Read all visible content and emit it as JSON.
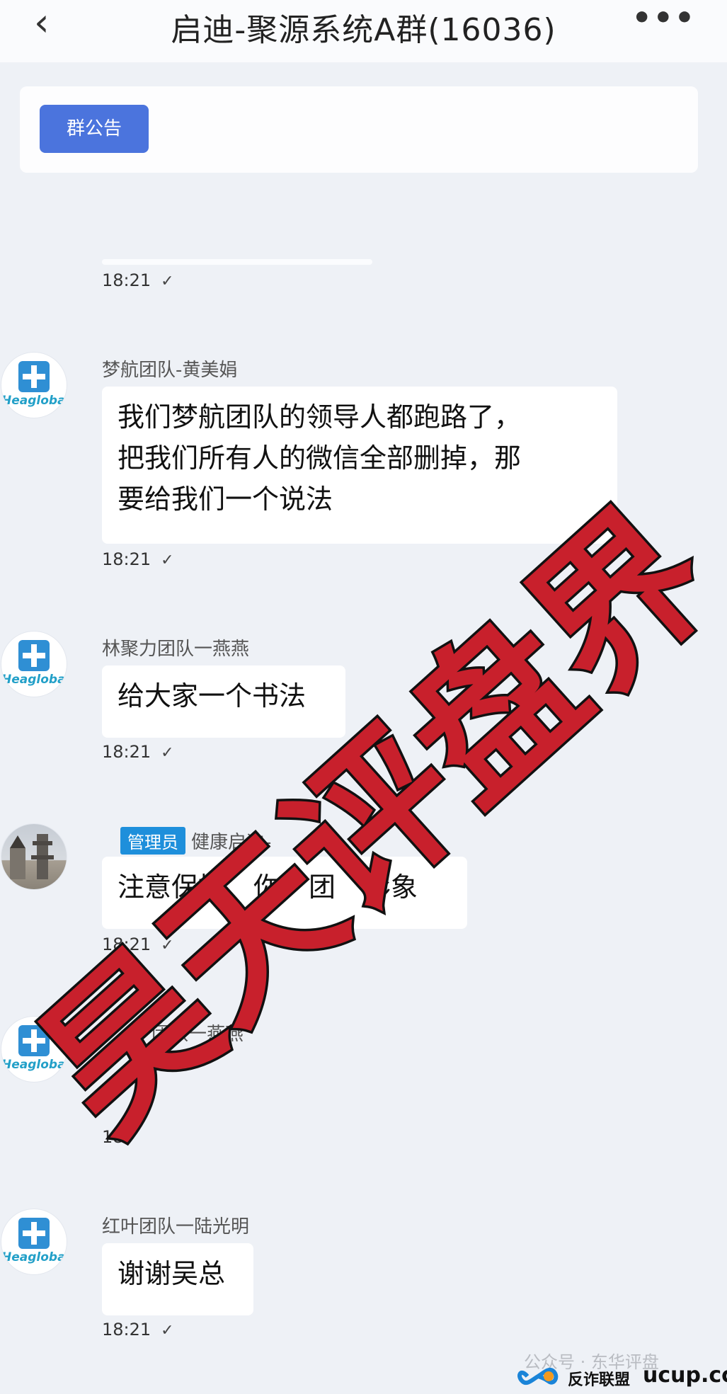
{
  "header": {
    "back_icon": "chevron-left-icon",
    "title": "启迪-聚源系统A群(16036)",
    "more_icon": "more-dots-icon"
  },
  "notice": {
    "button_label": "群公告"
  },
  "messages": [
    {
      "time": "18:21"
    },
    {
      "sender": "梦航团队-黄美娟",
      "text_lines": [
        "我们梦航团队的领导人都跑路了，",
        "把我们所有人的微信全部删掉，那",
        "要给我们一个说法"
      ],
      "time": "18:21",
      "avatar": "healthglobal-logo"
    },
    {
      "sender": "林聚力团队一燕燕",
      "text": "给大家一个书法",
      "time": "18:21",
      "avatar": "healthglobal-logo"
    },
    {
      "badge": "管理员",
      "sender": "健康启迪-",
      "text": "注意保持",
      "text_b": "你",
      "text_c": "团",
      "text_d": "形象",
      "time": "18:21",
      "avatar": "tower-photo"
    },
    {
      "sender": "团队一燕燕",
      "time": "18",
      "avatar": "healthglobal-logo"
    },
    {
      "sender": "红叶团队一陆光明",
      "text": "谢谢吴总",
      "time": "18:21",
      "avatar": "healthglobal-logo"
    }
  ],
  "avatar_logo_text": "Heaglobal",
  "check_icon": "✓",
  "watermark": {
    "text": "昊天评盘界",
    "color": "#c8202c"
  },
  "footer": {
    "account": "公众号 · 东华评盘",
    "brand_cn": "反诈联盟",
    "brand_url": "ucup.cc"
  }
}
